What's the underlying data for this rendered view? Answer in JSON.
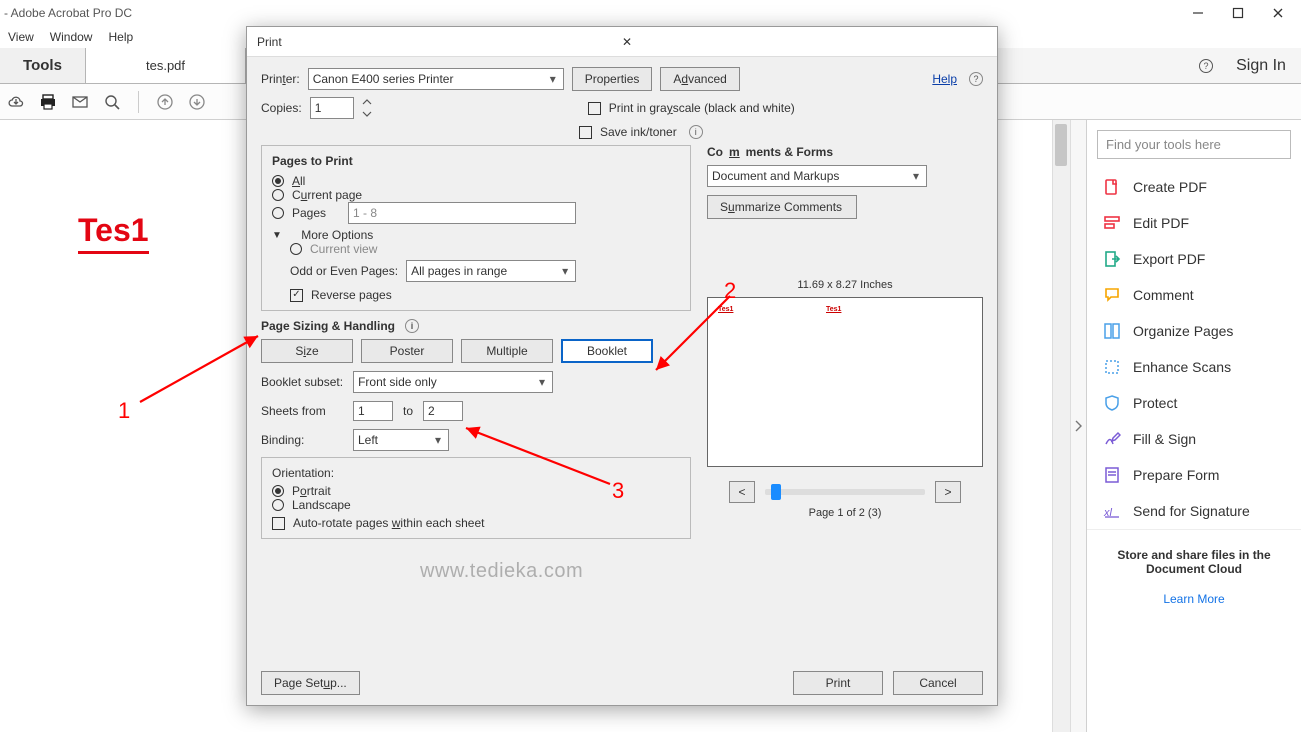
{
  "app_title": "- Adobe Acrobat Pro DC",
  "menu": {
    "view": "View",
    "window": "Window",
    "help": "Help"
  },
  "tabs": {
    "tools": "Tools",
    "file": "tes.pdf",
    "signin": "Sign In"
  },
  "doc": {
    "heading": "Tes1"
  },
  "watermark": "www.tedieka.com",
  "annotations": {
    "one": "1",
    "two": "2",
    "three": "3"
  },
  "right_panel": {
    "search_placeholder": "Find your tools here",
    "items": [
      "Create PDF",
      "Edit PDF",
      "Export PDF",
      "Comment",
      "Organize Pages",
      "Enhance Scans",
      "Protect",
      "Fill & Sign",
      "Prepare Form",
      "Send for Signature"
    ],
    "store_text": "Store and share files in the Document Cloud",
    "learn_more": "Learn More"
  },
  "dlg": {
    "title": "Print",
    "printer_lbl": "Printer:",
    "printer_val": "Canon E400 series Printer",
    "properties_btn": "Properties",
    "advanced_btn": "Advanced",
    "help": "Help",
    "copies_lbl": "Copies:",
    "copies_val": "1",
    "grayscale_lbl": "Print in grayscale (black and white)",
    "saveink_lbl": "Save ink/toner",
    "pages_to_print": {
      "title": "Pages to Print",
      "all": "All",
      "current": "Current page",
      "pages_lbl": "Pages",
      "pages_val": "1 - 8",
      "more": "More Options",
      "current_view": "Current view",
      "odd_even_lbl": "Odd or Even Pages:",
      "odd_even_val": "All pages in range",
      "reverse": "Reverse pages"
    },
    "sizing": {
      "title": "Page Sizing & Handling",
      "size": "Size",
      "poster": "Poster",
      "multiple": "Multiple",
      "booklet": "Booklet",
      "subset_lbl": "Booklet subset:",
      "subset_val": "Front side only",
      "sheets_lbl": "Sheets from",
      "sheets_from": "1",
      "sheets_to_lbl": "to",
      "sheets_to": "2",
      "binding_lbl": "Binding:",
      "binding_val": "Left"
    },
    "orientation": {
      "title": "Orientation:",
      "portrait": "Portrait",
      "landscape": "Landscape",
      "autorotate": "Auto-rotate pages within each sheet"
    },
    "comments_forms": {
      "title": "Comments & Forms",
      "value": "Document and Markups",
      "summarize": "Summarize Comments"
    },
    "preview": {
      "dim": "11.69 x 8.27 Inches",
      "pg1": "Tes1",
      "pg2": "Tes1",
      "counter": "Page 1 of 2 (3)"
    },
    "page_setup": "Page Setup...",
    "print_btn": "Print",
    "cancel_btn": "Cancel"
  }
}
